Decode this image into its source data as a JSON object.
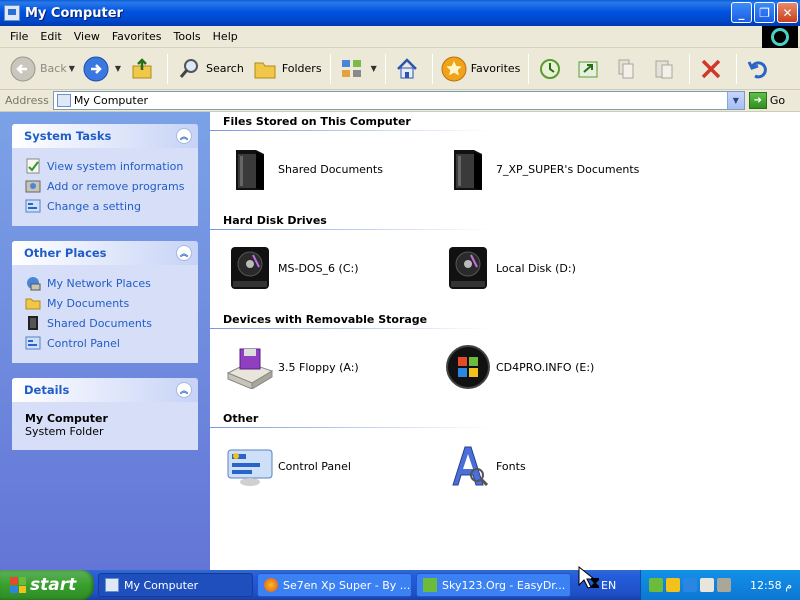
{
  "window": {
    "title": "My Computer",
    "buttons": {
      "minimize": "_",
      "maximize": "❐",
      "close": "✕"
    }
  },
  "menu": [
    "File",
    "Edit",
    "View",
    "Favorites",
    "Tools",
    "Help"
  ],
  "toolbar": {
    "back": "Back",
    "search": "Search",
    "folders": "Folders",
    "favorites": "Favorites"
  },
  "address": {
    "label": "Address",
    "value": "My Computer",
    "go": "Go"
  },
  "tasks": {
    "system": {
      "title": "System Tasks",
      "items": [
        "View system information",
        "Add or remove programs",
        "Change a setting"
      ]
    },
    "places": {
      "title": "Other Places",
      "items": [
        "My Network Places",
        "My Documents",
        "Shared Documents",
        "Control Panel"
      ]
    },
    "details": {
      "title": "Details",
      "name": "My Computer",
      "type": "System Folder"
    }
  },
  "groups": {
    "files": {
      "title": "Files Stored on This Computer",
      "items": [
        "Shared Documents",
        "7_XP_SUPER's Documents"
      ]
    },
    "hdd": {
      "title": "Hard Disk Drives",
      "items": [
        "MS-DOS_6 (C:)",
        "Local Disk (D:)"
      ]
    },
    "removable": {
      "title": "Devices with Removable Storage",
      "items": [
        "3.5 Floppy (A:)",
        "CD4PRO.INFO (E:)"
      ]
    },
    "other": {
      "title": "Other",
      "items": [
        "Control Panel",
        "Fonts"
      ]
    }
  },
  "taskbar": {
    "start": "start",
    "tasks": [
      "My Computer",
      "Se7en Xp Super - By ...",
      "Sky123.Org - EasyDr..."
    ],
    "lang": "EN",
    "clock": "12:58 م"
  },
  "colors": {
    "accent": "#215dc6",
    "taskbar": "#245edb",
    "start": "#38a02e",
    "leftpane": "#7ba2e7"
  }
}
